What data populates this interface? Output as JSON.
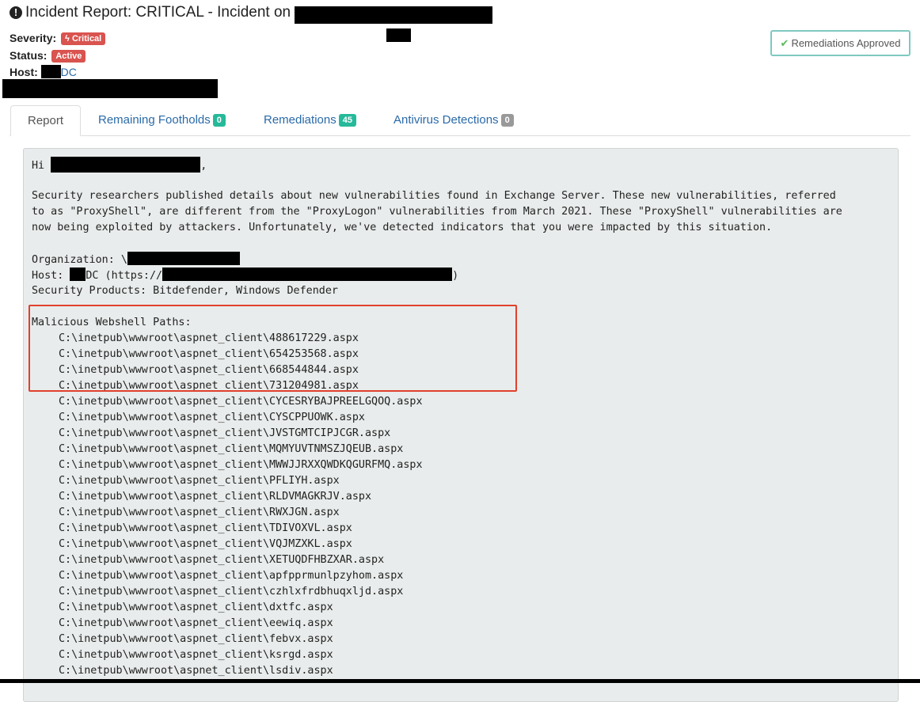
{
  "header": {
    "title": "Incident Report: CRITICAL - Incident on",
    "severity_label": "Severity:",
    "severity_value": "Critical",
    "status_label": "Status:",
    "status_value": "Active",
    "host_label": "Host:",
    "host_value": "DC",
    "remediations_button": "Remediations Approved"
  },
  "tabs": [
    {
      "label": "Report"
    },
    {
      "label": "Remaining Footholds",
      "count": "0"
    },
    {
      "label": "Remediations",
      "count": "45"
    },
    {
      "label": "Antivirus Detections",
      "count": "0"
    }
  ],
  "report": {
    "greeting_start": "Hi ",
    "greeting_end": ",",
    "paragraph": [
      "Security researchers published details about new vulnerabilities found in Exchange Server. These new vulnerabilities, referred",
      "to as \"ProxyShell\", are different from the \"ProxyLogon\" vulnerabilities from March 2021. These \"ProxyShell\" vulnerabilities are",
      "now being exploited by attackers. Unfortunately, we've detected indicators that you were impacted by this situation."
    ],
    "organization_label": "Organization: \\",
    "host_line_start": "Host: ",
    "host_line_mid": "DC (https://",
    "host_line_end": ")",
    "security_products": "Security Products: Bitdefender, Windows Defender",
    "webshell_heading": "Malicious Webshell Paths:",
    "webshell_paths": [
      "C:\\inetpub\\wwwroot\\aspnet_client\\488617229.aspx",
      "C:\\inetpub\\wwwroot\\aspnet_client\\654253568.aspx",
      "C:\\inetpub\\wwwroot\\aspnet_client\\668544844.aspx",
      "C:\\inetpub\\wwwroot\\aspnet_client\\731204981.aspx",
      "C:\\inetpub\\wwwroot\\aspnet_client\\CYCESRYBAJPREELGQOQ.aspx",
      "C:\\inetpub\\wwwroot\\aspnet_client\\CYSCPPUOWK.aspx",
      "C:\\inetpub\\wwwroot\\aspnet_client\\JVSTGMTCIPJCGR.aspx",
      "C:\\inetpub\\wwwroot\\aspnet_client\\MQMYUVTNMSZJQEUB.aspx",
      "C:\\inetpub\\wwwroot\\aspnet_client\\MWWJJRXXQWDKQGURFMQ.aspx",
      "C:\\inetpub\\wwwroot\\aspnet_client\\PFLIYH.aspx",
      "C:\\inetpub\\wwwroot\\aspnet_client\\RLDVMAGKRJV.aspx",
      "C:\\inetpub\\wwwroot\\aspnet_client\\RWXJGN.aspx",
      "C:\\inetpub\\wwwroot\\aspnet_client\\TDIVOXVL.aspx",
      "C:\\inetpub\\wwwroot\\aspnet_client\\VQJMZXKL.aspx",
      "C:\\inetpub\\wwwroot\\aspnet_client\\XETUQDFHBZXAR.aspx",
      "C:\\inetpub\\wwwroot\\aspnet_client\\apfpprmunlpzyhom.aspx",
      "C:\\inetpub\\wwwroot\\aspnet_client\\czhlxfrdbhuqxljd.aspx",
      "C:\\inetpub\\wwwroot\\aspnet_client\\dxtfc.aspx",
      "C:\\inetpub\\wwwroot\\aspnet_client\\eewiq.aspx",
      "C:\\inetpub\\wwwroot\\aspnet_client\\febvx.aspx",
      "C:\\inetpub\\wwwroot\\aspnet_client\\ksrgd.aspx",
      "C:\\inetpub\\wwwroot\\aspnet_client\\lsdiv.aspx"
    ]
  },
  "icons": {
    "title_icon": "exclamation-circle-icon",
    "severity_icon": "bolt-icon",
    "button_icon": "check-icon"
  },
  "colors": {
    "critical": "#d9534f",
    "link": "#2a6aa8",
    "count_badge": "#26b99a",
    "count_badge_zero": "#999999",
    "highlight": "#e0412d",
    "report_bg": "#e9ecec"
  }
}
